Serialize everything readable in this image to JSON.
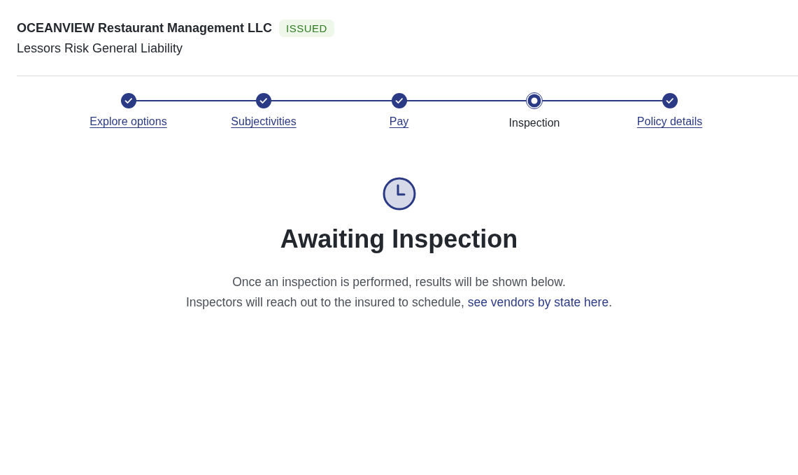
{
  "header": {
    "title": "OCEANVIEW Restaurant Management LLC",
    "status_badge": "ISSUED",
    "subtitle": "Lessors Risk General Liability"
  },
  "stepper": [
    {
      "label": "Explore options",
      "completed": true,
      "selected": false
    },
    {
      "label": "Subjectivities",
      "completed": true,
      "selected": false
    },
    {
      "label": "Pay",
      "completed": true,
      "selected": false
    },
    {
      "label": "Inspection",
      "completed": false,
      "selected": true
    },
    {
      "label": "Policy details",
      "completed": true,
      "selected": false
    }
  ],
  "status_panel": {
    "heading": "Awaiting Inspection",
    "line_1": "Once an inspection is performed, results will be shown below.",
    "line_2": "Inspectors will reach out to the insured to schedule,",
    "link": "see vendors by state here",
    "link_suffix": "."
  }
}
